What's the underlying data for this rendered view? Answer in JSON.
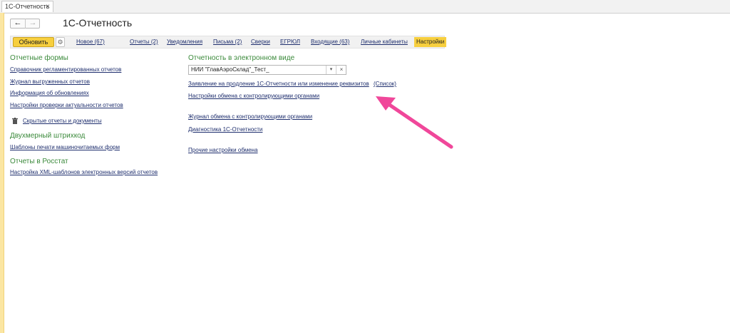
{
  "tab": {
    "label": "1С-Отчетность",
    "close": "×"
  },
  "nav": {
    "back": "←",
    "forward": "→"
  },
  "header": {
    "title": "1С-Отчетность"
  },
  "toolbar": {
    "refresh": "Обновить",
    "gear": "⚙",
    "links": [
      "Новое (67)",
      "Отчеты (2)",
      "Уведомления",
      "Письма (2)",
      "Сверки",
      "ЕГРЮЛ",
      "Входящие (63)",
      "Личные кабинеты",
      "Настройки"
    ]
  },
  "left": {
    "forms_title": "Отчетные формы",
    "forms_links": [
      "Справочник регламентированных отчетов",
      "Журнал выгруженных отчетов",
      "Информация об обновлениях",
      "Настройки проверки актуальности отчетов"
    ],
    "hidden_link": "Скрытые отчеты и документы",
    "barcode_title": "Двухмерный штрихкод",
    "barcode_link": "Шаблоны печати машиночитаемых форм",
    "rosstat_title": "Отчеты в Росстат",
    "rosstat_link": "Настройка XML-шаблонов электронных версий отчетов"
  },
  "right": {
    "title": "Отчетность в электронном виде",
    "org_value": "НИИ \"ГлавАэроСклад\"_Тест_",
    "dropdown_glyph": "▾",
    "clear_glyph": "×",
    "links": {
      "application": "Заявление на продление 1С-Отчетности или изменение реквизитов",
      "list": "(Список)",
      "exchange_settings": "Настройки обмена с контролирующими органами",
      "exchange_log": "Журнал обмена с контролирующими органами",
      "diagnostics": "Диагностика 1С-Отчетности",
      "other_settings": "Прочие настройки обмена"
    }
  },
  "colors": {
    "accent_yellow": "#f7cf3e",
    "section_green": "#3b8a3b",
    "link_blue": "#1f2f6e",
    "annotation_pink": "#f0479a"
  }
}
